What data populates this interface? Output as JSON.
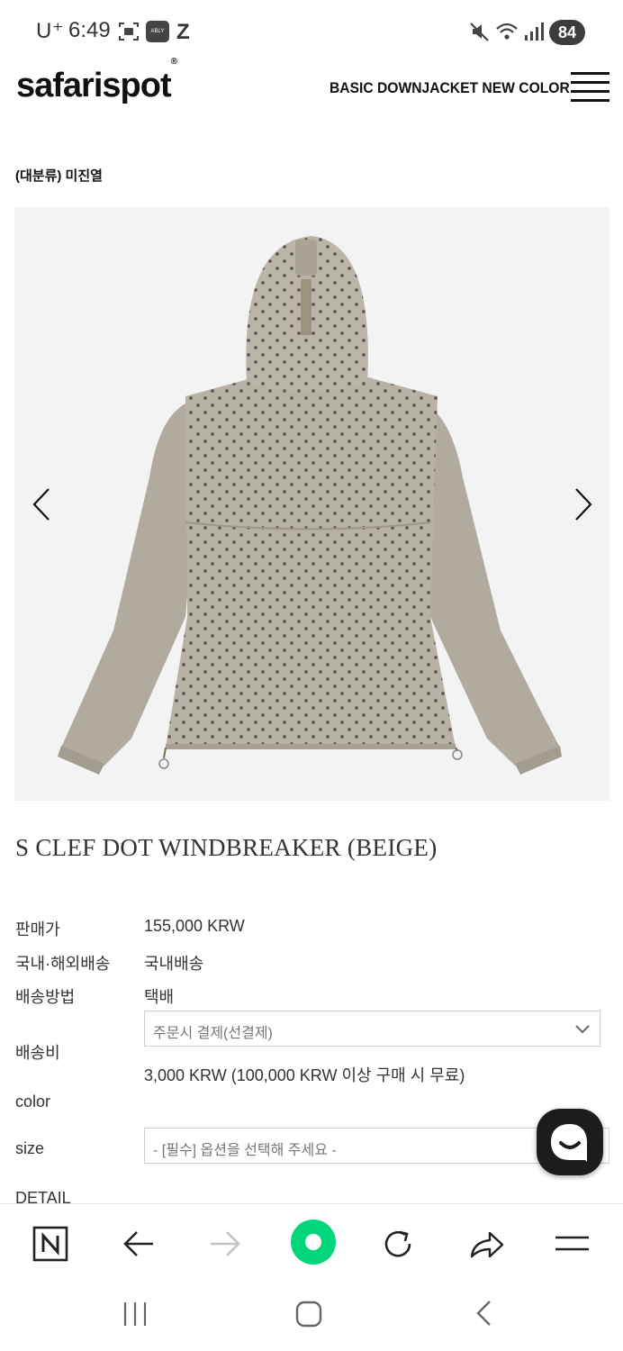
{
  "status_bar": {
    "carrier": "U⁺",
    "time": "6:49",
    "battery": "84",
    "icons": [
      "screen-record-icon",
      "ably-app-icon",
      "z-app-icon",
      "mute-icon",
      "wifi-icon",
      "signal-icon"
    ],
    "ably_label": "ABLY",
    "z_label": "Z"
  },
  "header": {
    "logo": "safarispot",
    "logo_mark": "®",
    "promo": "BASIC DOWNJACKET NEW COLOR",
    "menu_icon": "hamburger-icon"
  },
  "breadcrumb": "(대분류) 미진열",
  "gallery": {
    "prev_icon": "chevron-left-icon",
    "next_icon": "chevron-right-icon",
    "image_alt": "windbreaker-back-view"
  },
  "product": {
    "title": "S CLEF DOT WINDBREAKER (BEIGE)",
    "rows": {
      "price_label": "판매가",
      "price_value": "155,000 KRW",
      "shipping_region_label": "국내·해외배송",
      "shipping_region_value": "국내배송",
      "shipping_method_label": "배송방법",
      "shipping_method_value": "택배",
      "shipping_fee_label": "배송비",
      "shipping_fee_select": "주문시 결제(선결제)",
      "shipping_fee_note": "3,000 KRW (100,000 KRW 이상 구매 시 무료)",
      "color_label": "color",
      "size_label": "size",
      "size_placeholder": "- [필수] 옵션을 선택해 주세요 -",
      "detail_label": "DETAIL"
    }
  },
  "chat_button": "chat-bubble-icon",
  "browser_toolbar": [
    "naver-n-icon",
    "back-arrow-icon",
    "forward-arrow-icon",
    "green-dot-icon",
    "refresh-icon",
    "share-icon",
    "menu-lines-icon"
  ],
  "colors": {
    "accent_green": "#03d67a",
    "jacket": "#b3ada2",
    "text": "#333333"
  }
}
